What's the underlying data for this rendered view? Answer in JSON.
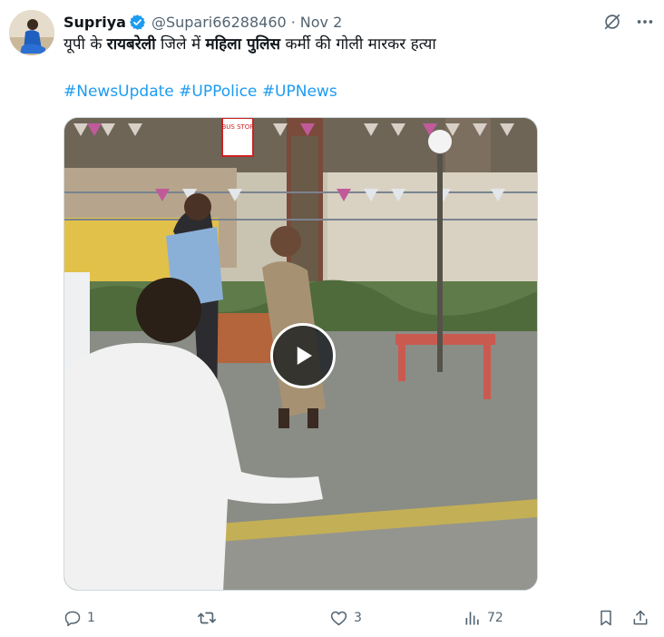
{
  "tweet": {
    "author": {
      "display_name": "Supriya",
      "handle": "@Supari66288460",
      "verified": true
    },
    "separator": "·",
    "date": "Nov 2",
    "text": {
      "part1": "यूपी के ",
      "bold1": "रायबरेली",
      "part2": " जिले में ",
      "bold2": "महिला पुलिस",
      "part3": " कर्मी की गोली मारकर हत्या"
    },
    "hashtags": [
      "#NewsUpdate",
      "#UPPolice",
      "#UPNews"
    ],
    "media": {
      "type": "video",
      "sign_text": "BUS STOP"
    },
    "actions": {
      "replies": "1",
      "retweets": "",
      "likes": "3",
      "views": "72"
    }
  },
  "icons": {
    "verified": "verified-badge-icon",
    "grok": "grok-icon",
    "more": "more-icon",
    "reply": "reply-icon",
    "retweet": "retweet-icon",
    "like": "like-icon",
    "views": "views-icon",
    "bookmark": "bookmark-icon",
    "share": "share-icon",
    "play": "play-icon"
  },
  "colors": {
    "link": "#1d9bf0",
    "verified": "#1d9bf0",
    "secondary_text": "#536471",
    "primary_text": "#0f1419"
  }
}
